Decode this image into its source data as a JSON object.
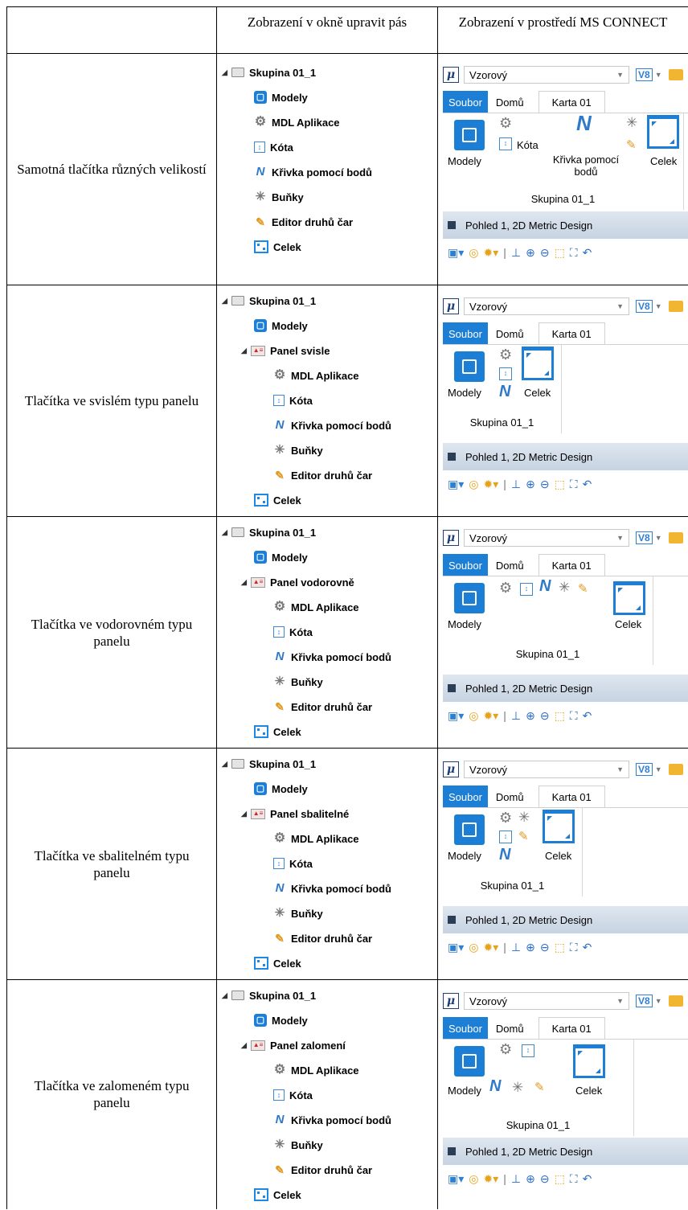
{
  "header": {
    "col2": "Zobrazení v okně upravit pás",
    "col3": "Zobrazení v prostředí MS CONNECT"
  },
  "rows": [
    {
      "label": "Samotná tlačítka různých velikostí",
      "panel": ""
    },
    {
      "label": "Tlačítka ve svislém typu panelu",
      "panel": "Panel svisle"
    },
    {
      "label": "Tlačítka ve vodorovném typu panelu",
      "panel": "Panel vodorovně"
    },
    {
      "label": "Tlačítka ve sbalitelném typu panelu",
      "panel": "Panel sbalitelné"
    },
    {
      "label": "Tlačítka ve zalomeném typu panelu",
      "panel": "Panel zalomení"
    }
  ],
  "tree": {
    "group": "Skupina 01_1",
    "models": "Modely",
    "mdl": "MDL Aplikace",
    "kota": "Kóta",
    "krivka": "Křivka pomocí bodů",
    "bunky": "Buňky",
    "editor": "Editor druhů čar",
    "celek": "Celek"
  },
  "ribbon": {
    "workspace": "Vzorový",
    "v8": "V8",
    "tab_file": "Soubor",
    "tab_home": "Domů",
    "tab_active": "Karta 01",
    "group_name": "Skupina 01_1",
    "btn_models": "Modely",
    "btn_kota": "Kóta",
    "btn_krivka": "Křivka pomocí bodů",
    "btn_celek": "Celek",
    "view_title": "Pohled 1, 2D Metric Design"
  }
}
